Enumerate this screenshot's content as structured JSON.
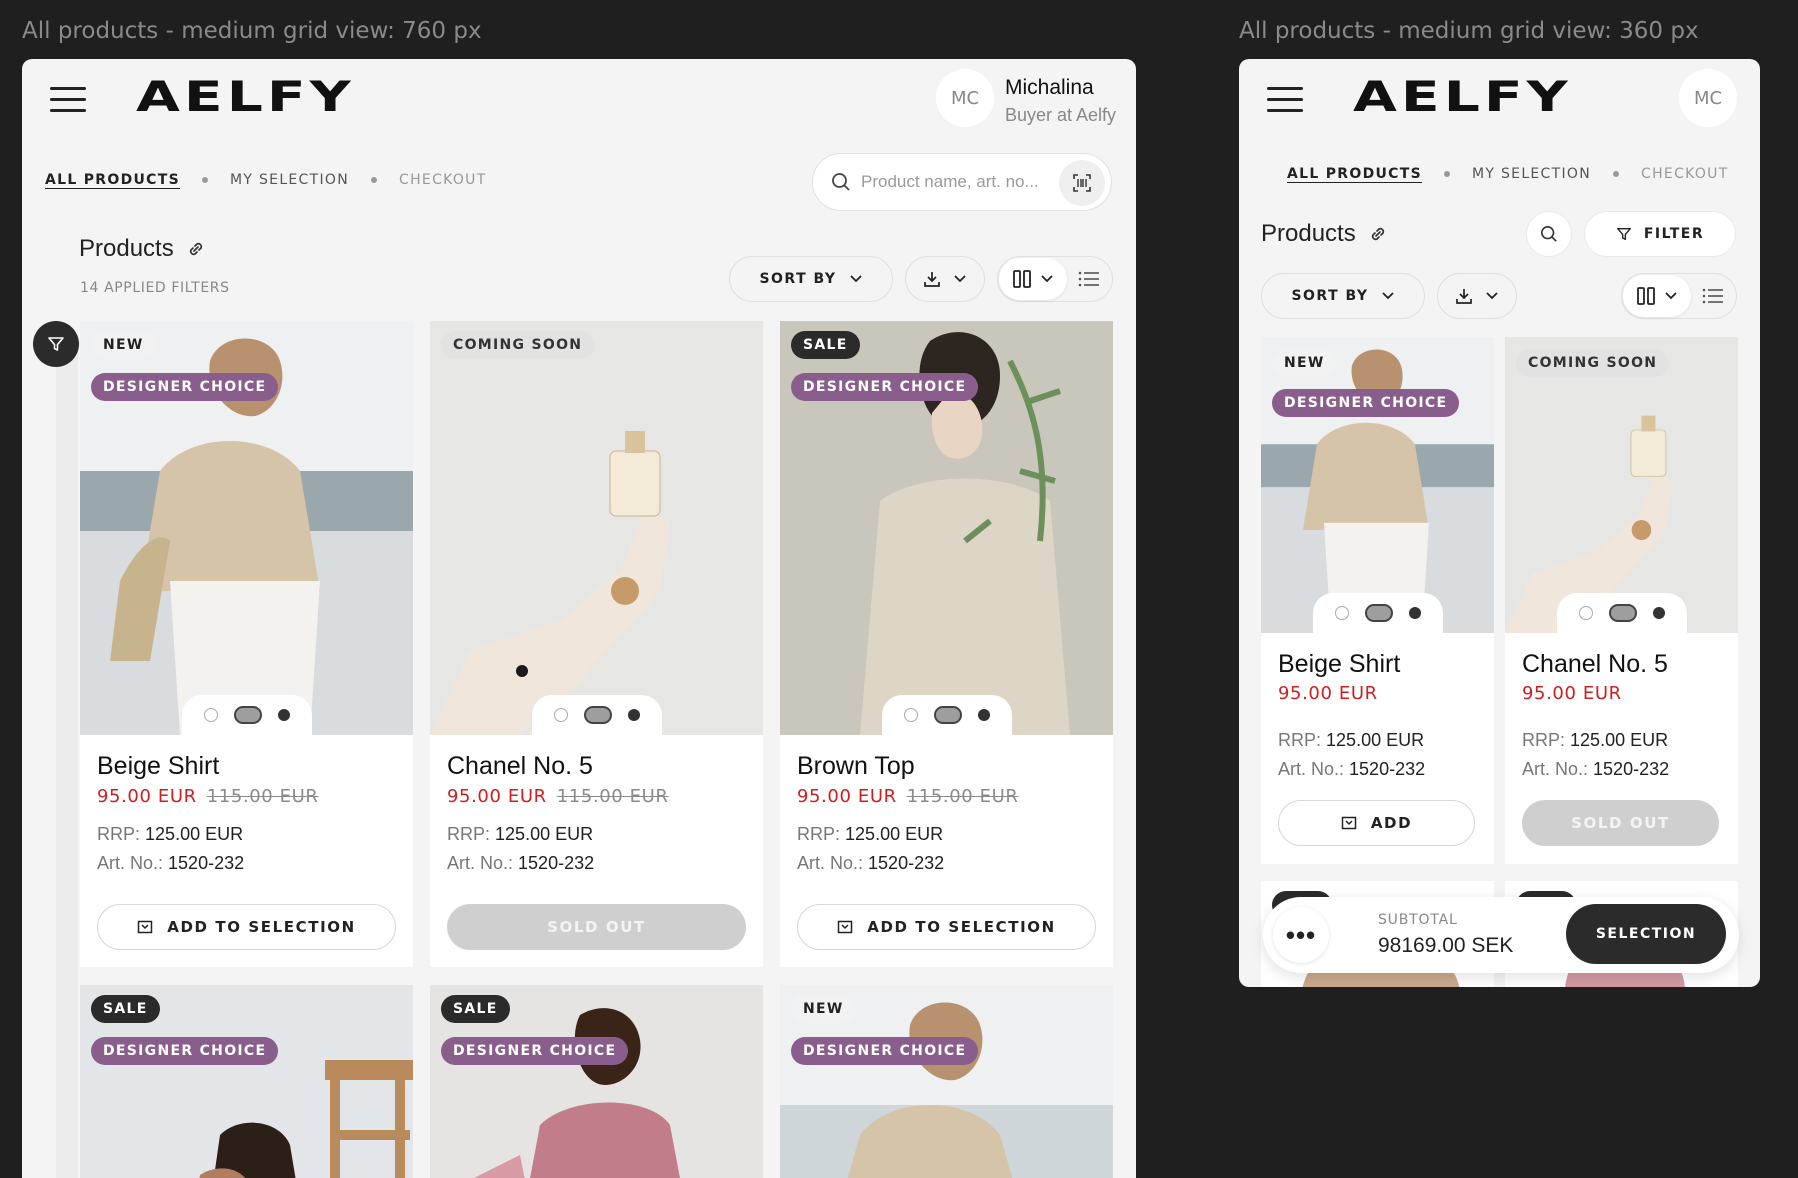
{
  "captions": {
    "left": "All products - medium grid view: 760 px",
    "right": "All products - medium grid view: 360 px"
  },
  "colors": {
    "accent_price": "#cc1f1f",
    "tag_purple": "#8a5e8c",
    "dark": "#2b2b2b",
    "frame_bg": "#f4f4f4",
    "canvas_bg": "#1f1f1f"
  },
  "header": {
    "logo": "AELFY",
    "avatar_initials": "MC",
    "user_name": "Michalina",
    "user_role": "Buyer at Aelfy",
    "menu_icon": "hamburger-icon"
  },
  "nav": {
    "all_products": "ALL PRODUCTS",
    "my_selection": "MY SELECTION",
    "checkout": "CHECKOUT"
  },
  "search": {
    "placeholder": "Product name, art. no...",
    "icon": "search-icon",
    "scan_icon": "barcode-scan-icon"
  },
  "toolbar": {
    "title": "Products",
    "link_icon": "link-icon",
    "applied_filters": "14 APPLIED FILTERS",
    "sort_label": "SORT BY",
    "filter_label": "FILTER",
    "download_icon": "download-icon",
    "grid_view_icon": "grid-view-icon",
    "list_view_icon": "list-view-icon"
  },
  "labels": {
    "rrp": "RRP:",
    "art_no": "Art. No.:",
    "add_to_selection": "ADD TO SELECTION",
    "add": "ADD",
    "sold_out": "SOLD OUT"
  },
  "products": [
    {
      "name": "Beige Shirt",
      "price": "95.00 EUR",
      "old_price": "115.00 EUR",
      "rrp": "125.00 EUR",
      "art_no": "1520-232",
      "badge": "NEW",
      "badge2": "DESIGNER CHOICE",
      "available": true,
      "image": "woman in beige shirt by the sea"
    },
    {
      "name": "Chanel No. 5",
      "price": "95.00 EUR",
      "old_price": "115.00 EUR",
      "rrp": "125.00 EUR",
      "art_no": "1520-232",
      "badge": "COMING SOON",
      "badge2": "",
      "available": false,
      "image": "hand holding perfume bottle"
    },
    {
      "name": "Brown Top",
      "price": "95.00 EUR",
      "old_price": "115.00 EUR",
      "rrp": "125.00 EUR",
      "art_no": "1520-232",
      "badge": "SALE",
      "badge2": "DESIGNER CHOICE",
      "available": true,
      "image": "woman with eucalyptus branch"
    },
    {
      "badge": "SALE",
      "badge2": "DESIGNER CHOICE",
      "image": "woman beside wooden chair"
    },
    {
      "badge": "SALE",
      "badge2": "DESIGNER CHOICE",
      "image": "woman in pink dress"
    },
    {
      "badge": "NEW",
      "badge2": "DESIGNER CHOICE",
      "image": "woman in beige shirt"
    }
  ],
  "mobile_products": [
    {
      "name": "Beige Shirt",
      "price": "95.00 EUR",
      "rrp": "125.00 EUR",
      "art_no": "1520-232",
      "badge": "NEW",
      "badge2": "DESIGNER CHOICE"
    },
    {
      "name": "Chanel No. 5",
      "price": "95.00 EUR",
      "rrp": "125.00 EUR",
      "art_no": "1520-232",
      "badge": "COMING SOON",
      "badge2": ""
    }
  ],
  "subtotal": {
    "label": "SUBTOTAL",
    "value": "98169.00 SEK",
    "button": "SELECTION",
    "more": "•••"
  }
}
